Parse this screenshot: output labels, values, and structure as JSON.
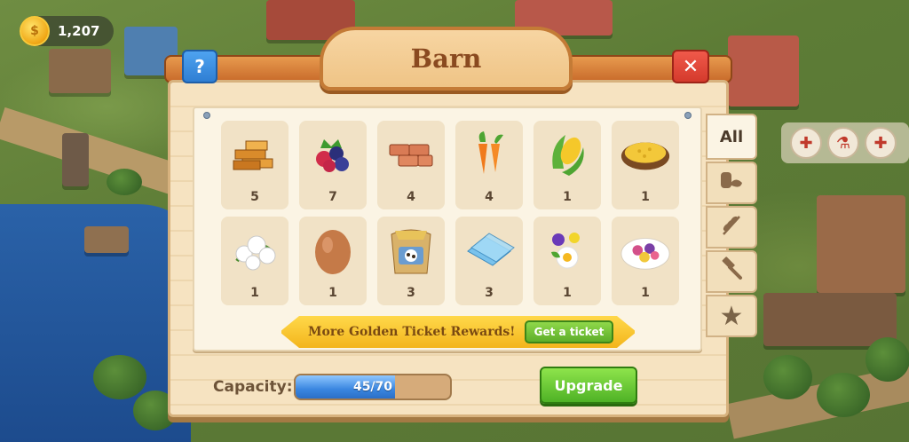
{
  "hud": {
    "coins": "1,207"
  },
  "dialog": {
    "title": "Barn",
    "help_label": "?",
    "close_label": "✕",
    "items": [
      {
        "name": "wood-planks",
        "qty": "5"
      },
      {
        "name": "berries",
        "qty": "7"
      },
      {
        "name": "bricks",
        "qty": "4"
      },
      {
        "name": "carrots",
        "qty": "4"
      },
      {
        "name": "corn",
        "qty": "1"
      },
      {
        "name": "corn-feed",
        "qty": "1"
      },
      {
        "name": "cotton",
        "qty": "1"
      },
      {
        "name": "egg",
        "qty": "1"
      },
      {
        "name": "cow-feed",
        "qty": "3"
      },
      {
        "name": "glass",
        "qty": "3"
      },
      {
        "name": "flowers",
        "qty": "1"
      },
      {
        "name": "fruit-salad",
        "qty": "1"
      }
    ],
    "banner_text": "More Golden Ticket Rewards!",
    "ticket_button": "Get a ticket",
    "capacity_label": "Capacity:",
    "capacity_text": "45/70",
    "capacity_used": 45,
    "capacity_max": 70,
    "upgrade_button": "Upgrade",
    "tabs": [
      {
        "label": "All",
        "icon": "all"
      },
      {
        "label": "",
        "icon": "bread-icon"
      },
      {
        "label": "",
        "icon": "wheat-icon"
      },
      {
        "label": "",
        "icon": "hammer-icon"
      },
      {
        "label": "",
        "icon": "star-icon"
      }
    ]
  }
}
